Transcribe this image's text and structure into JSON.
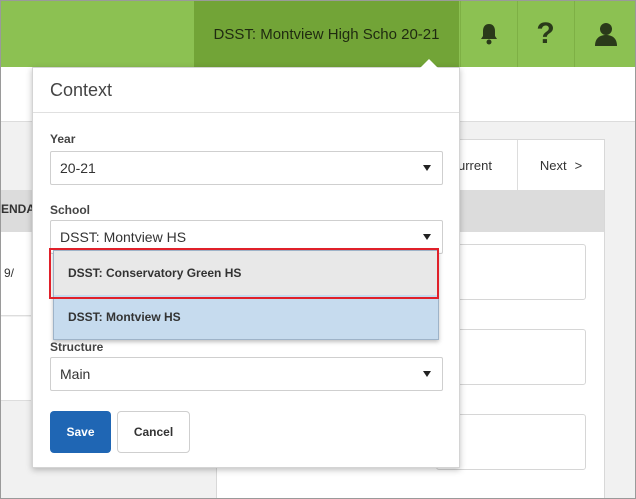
{
  "topbar": {
    "context_label": "DSST: Montview High Scho 20-21",
    "icons": [
      "bell-icon",
      "help-icon",
      "user-icon"
    ],
    "help_glyph": "?",
    "color": "#8cc152",
    "active_color": "#72a437"
  },
  "background": {
    "nav_current": "urrent",
    "nav_next": "Next",
    "nav_next_chevron": ">",
    "column_header_fragment": "ENDA",
    "date_fragment": "9/"
  },
  "context": {
    "title": "Context",
    "year": {
      "label": "Year",
      "value": "20-21"
    },
    "school": {
      "label": "School",
      "value": "DSST: Montview HS",
      "options": [
        "DSST: Conservatory Green HS",
        "DSST: Montview HS"
      ]
    },
    "structure": {
      "label": "Structure",
      "value": "Main"
    },
    "save_label": "Save",
    "cancel_label": "Cancel"
  }
}
